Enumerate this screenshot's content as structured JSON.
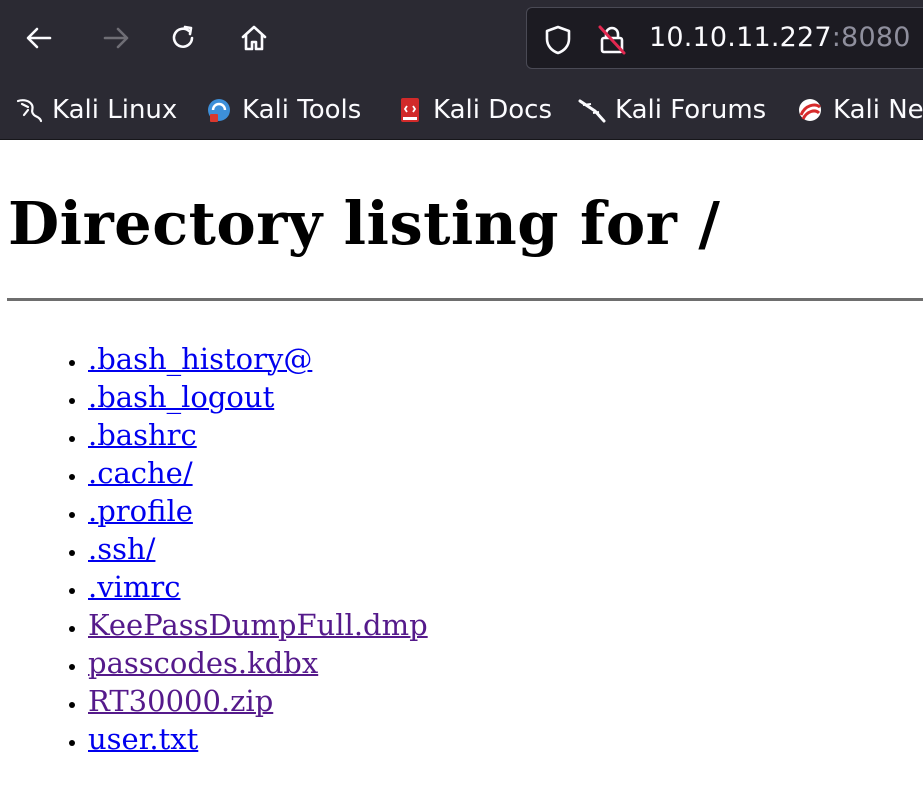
{
  "browser": {
    "url_host": "10.10.11.227",
    "url_port": ":8080",
    "bookmarks": [
      {
        "label": "Kali Linux",
        "icon": "kali-dragon-icon"
      },
      {
        "label": "Kali Tools",
        "icon": "kali-tools-icon"
      },
      {
        "label": "Kali Docs",
        "icon": "kali-docs-icon"
      },
      {
        "label": "Kali Forums",
        "icon": "kali-forums-icon"
      },
      {
        "label": "Kali Ne",
        "icon": "kali-nethunter-icon"
      }
    ]
  },
  "page": {
    "title": "Directory listing for /",
    "files": [
      {
        "name": ".bash_history@",
        "visited": false
      },
      {
        "name": ".bash_logout",
        "visited": false
      },
      {
        "name": ".bashrc",
        "visited": false
      },
      {
        "name": ".cache/",
        "visited": false
      },
      {
        "name": ".profile",
        "visited": false
      },
      {
        "name": ".ssh/",
        "visited": false
      },
      {
        "name": ".vimrc",
        "visited": false
      },
      {
        "name": "KeePassDumpFull.dmp",
        "visited": true
      },
      {
        "name": "passcodes.kdbx",
        "visited": true
      },
      {
        "name": "RT30000.zip",
        "visited": true
      },
      {
        "name": "user.txt",
        "visited": false
      }
    ]
  },
  "colors": {
    "link": "#0000ee",
    "visited_link": "#551a8b",
    "toolbar": "#2b2a33"
  }
}
